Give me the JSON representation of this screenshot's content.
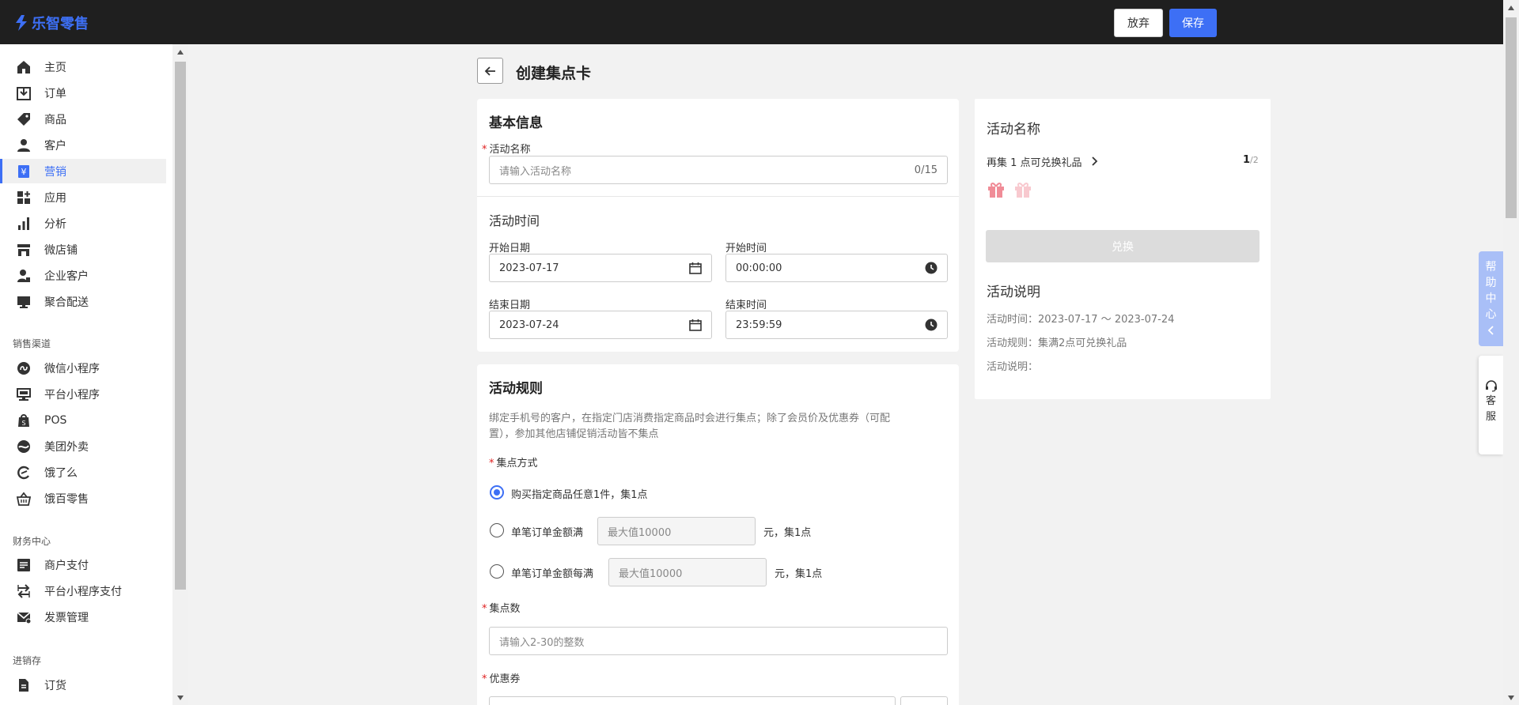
{
  "app": {
    "logo_text": "乐智零售",
    "brand_color": "#3d6ff5"
  },
  "header": {
    "abandon_label": "放弃",
    "save_label": "保存"
  },
  "sidebar": {
    "items": [
      {
        "label": "主页",
        "icon": "home-icon"
      },
      {
        "label": "订单",
        "icon": "order-icon"
      },
      {
        "label": "商品",
        "icon": "tag-icon"
      },
      {
        "label": "客户",
        "icon": "person-icon"
      },
      {
        "label": "营销",
        "icon": "yen-icon",
        "active": true
      },
      {
        "label": "应用",
        "icon": "apps-icon"
      },
      {
        "label": "分析",
        "icon": "bar-chart-icon"
      },
      {
        "label": "微店铺",
        "icon": "store-icon"
      },
      {
        "label": "企业客户",
        "icon": "enterprise-user-icon"
      },
      {
        "label": "聚合配送",
        "icon": "monitor-icon"
      }
    ],
    "sections": [
      {
        "title": "销售渠道",
        "items": [
          {
            "label": "微信小程序",
            "icon": "mini-program-icon"
          },
          {
            "label": "平台小程序",
            "icon": "platform-store-icon"
          },
          {
            "label": "POS",
            "icon": "shopify-bag-icon"
          },
          {
            "label": "美团外卖",
            "icon": "meituan-icon"
          },
          {
            "label": "饿了么",
            "icon": "eleme-icon"
          },
          {
            "label": "饿百零售",
            "icon": "basket-icon"
          }
        ]
      },
      {
        "title": "财务中心",
        "items": [
          {
            "label": "商户支付",
            "icon": "list-icon"
          },
          {
            "label": "平台小程序支付",
            "icon": "transfer-icon"
          },
          {
            "label": "发票管理",
            "icon": "invoice-mail-icon"
          }
        ]
      },
      {
        "title": "进销存",
        "items": [
          {
            "label": "订货",
            "icon": "document-icon"
          }
        ]
      }
    ]
  },
  "page": {
    "title": "创建集点卡"
  },
  "basic": {
    "title": "基本信息",
    "name_label": "活动名称",
    "name_placeholder": "请输入活动名称",
    "name_count": "0/15",
    "time_title": "活动时间",
    "start_date_label": "开始日期",
    "start_date": "2023-07-17",
    "start_time_label": "开始时间",
    "start_time": "00:00:00",
    "end_date_label": "结束日期",
    "end_date": "2023-07-24",
    "end_time_label": "结束时间",
    "end_time": "23:59:59"
  },
  "rules": {
    "title": "活动规则",
    "desc_line1": "绑定手机号的客户，在指定门店消费指定商品时会进行集点；除了会员价及优惠券（可配",
    "desc_line2": "置），参加其他店铺促销活动皆不集点",
    "method_label": "集点方式",
    "option1": "购买指定商品任意1件，集1点",
    "option2": "单笔订单金额满",
    "option2_placeholder": "最大值10000",
    "option2_suffix": "元，集1点",
    "option3": "单笔订单金额每满",
    "option3_placeholder": "最大值10000",
    "option3_suffix": "元，集1点",
    "points_label": "集点数",
    "points_placeholder": "请输入2-30的整数",
    "coupon_label": "优惠券"
  },
  "preview": {
    "name_title": "活动名称",
    "progress_text": "再集 1 点可兑换礼品",
    "progress_current": "1",
    "progress_total": "/2",
    "exchange_label": "兑换",
    "desc_title": "活动说明",
    "time_line": "活动时间：2023-07-17 ～ 2023-07-24",
    "rule_line": "活动规则：集满2点可兑换礼品",
    "note_line": "活动说明："
  },
  "float": {
    "help_chars": [
      "帮",
      "助",
      "中",
      "心"
    ],
    "service_chars": [
      "客",
      "服"
    ]
  }
}
